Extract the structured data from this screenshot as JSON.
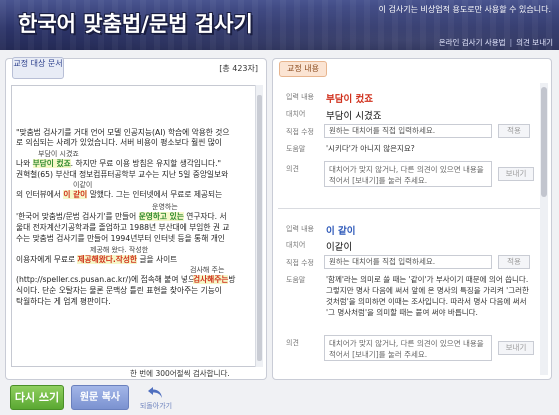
{
  "header": {
    "title": "한국어 맞춤법/문법 검사기",
    "notice": "이 검사기는 비상업적 용도로만 사용할 수 있습니다.",
    "links": [
      "온라인 검사기 사용법",
      "|",
      "의견 보내기"
    ]
  },
  "left": {
    "tab": "교정 대상 문서",
    "char_count": "[총 423자]",
    "lines": [
      "\"맞춤법 검사기를 거대 언어 모델 인공지능(AI) 학습에 악용한 것으",
      "로 의심되는 사례가 있었습니다. 서버 비용이 평소보다 훨씬 많이",
      "나와",
      "부담이 컸죠",
      ". 하지만 무료 이용 방침은 유지할 생각입니다.\"",
      "권혁철(65) 부산대 정보컴퓨터공학부 교수는 지난 5일 중앙일보와",
      "의 인터뷰에서",
      "이 같이",
      "말했다. 그는 인터넷에서 무료로 제공되는",
      "'한국어 맞춤법/문법 검사기'를 만들어",
      "운영하고 있는",
      "연구자다. 서",
      "울대 전자계산기공학과를 졸업하고 1988년 부산대에 부임한 권 교",
      "수는 맞춤법 검사기를 만들어 1994년부터 인터넷 등을 통해 개인",
      "이용자에게 무료로",
      "제공해왔다.작성한",
      "글을 사이트",
      "(http://speller.cs.pusan.ac.kr/)에 접속해 붙여 넣으면",
      "검사해주는",
      "방",
      "식이다. 단순 오탈자는 물론 문맥상 틀린 표현을 찾아주는 기능이",
      "탁월하다는 게 업계 평판이다."
    ],
    "suggestions": [
      "부담이 시겼죠",
      "이같이",
      "운영하는",
      "제공해 왔다. 작성한",
      "검사해 주는"
    ],
    "bottom_note": "한 번에 300어절씩 검사합니다."
  },
  "right": {
    "tab": "교정 내용",
    "cards": [
      {
        "labels": {
          "input": "입력 내용",
          "replace": "대치어",
          "direct": "직접 수정",
          "help": "도움말",
          "opinion": "의견"
        },
        "input_value": "부담이 컸죠",
        "replace_value": "부담이 시겼죠",
        "direct_placeholder": "원하는 대치어를 직접 입력하세요.",
        "apply_label": "적용",
        "help_text": "'시키다'가 아니지 않은지요?",
        "opinion_placeholder": "대치어가 맞지 않거나, 다른 의견이 있으면 내용을 적어서 [보내기]를 눌러 주세요.",
        "send_label": "보내기"
      },
      {
        "labels": {
          "input": "입력 내용",
          "replace": "대치어",
          "direct": "직접 수정",
          "help": "도움말",
          "opinion": "의견"
        },
        "input_value": "이 같이",
        "replace_value": "이같이",
        "direct_placeholder": "원하는 대치어를 직접 입력하세요.",
        "apply_label": "적용",
        "help_text": "'함께'라는 의미로 쓸 때는 '같이'가 부사이기 때문에 의어 씁니다. 그렇지만 명사 다음에 써서 앞에 온 명사의 특징을 가리켜 '그러한 것처럼'을 의미하면 이때는 조사입니다. 따라서 명사 다음에 써서 '그 명사처럼'을 의미할 때는 붙여 써야 바릅니다.",
        "opinion_placeholder": "대치어가 맞지 않거나, 다른 의견이 있으면 내용을 적어서 [보내기]를 눌러 주세요.",
        "send_label": "보내기"
      }
    ]
  },
  "buttons": {
    "rewrite": "다시 쓰기",
    "copy": "원문 복사",
    "undo": "되돌아가기"
  },
  "colors": {
    "header": "#2d356a",
    "error_red": "#d0301c",
    "error_green": "#2f8a2f",
    "rewrite_green": "#5aa832",
    "copy_blue": "#7b92d0"
  }
}
